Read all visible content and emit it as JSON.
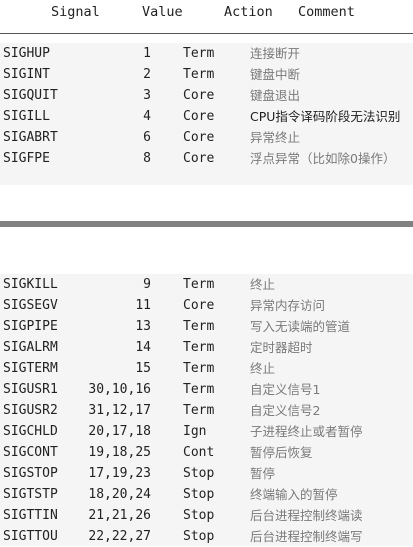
{
  "header": {
    "signal": "Signal",
    "value": "Value",
    "action": "Action",
    "comment": "Comment"
  },
  "table1": [
    {
      "signal": "SIGHUP",
      "value": "1",
      "action": "Term",
      "comment": "连接断开"
    },
    {
      "signal": "SIGINT",
      "value": "2",
      "action": "Term",
      "comment": "键盘中断"
    },
    {
      "signal": "SIGQUIT",
      "value": "3",
      "action": "Core",
      "comment": "键盘退出"
    },
    {
      "signal": "SIGILL",
      "value": "4",
      "action": "Core",
      "comment": "CPU指令译码阶段无法识别"
    },
    {
      "signal": "SIGABRT",
      "value": "6",
      "action": "Core",
      "comment": "异常终止"
    },
    {
      "signal": "SIGFPE",
      "value": "8",
      "action": "Core",
      "comment": "浮点异常（比如除0操作）"
    }
  ],
  "table2": [
    {
      "signal": "SIGKILL",
      "value": "9",
      "action": "Term",
      "comment": "终止"
    },
    {
      "signal": "SIGSEGV",
      "value": "11",
      "action": "Core",
      "comment": "异常内存访问"
    },
    {
      "signal": "SIGPIPE",
      "value": "13",
      "action": "Term",
      "comment": "写入无读端的管道"
    },
    {
      "signal": "SIGALRM",
      "value": "14",
      "action": "Term",
      "comment": "定时器超时"
    },
    {
      "signal": "SIGTERM",
      "value": "15",
      "action": "Term",
      "comment": "终止"
    },
    {
      "signal": "SIGUSR1",
      "value": "30,10,16",
      "action": "Term",
      "comment": "自定义信号1"
    },
    {
      "signal": "SIGUSR2",
      "value": "31,12,17",
      "action": "Term",
      "comment": "自定义信号2"
    },
    {
      "signal": "SIGCHLD",
      "value": "20,17,18",
      "action": "Ign",
      "comment": "子进程终止或者暂停"
    },
    {
      "signal": "SIGCONT",
      "value": "19,18,25",
      "action": "Cont",
      "comment": "暂停后恢复"
    },
    {
      "signal": "SIGSTOP",
      "value": "17,19,23",
      "action": "Stop",
      "comment": "暂停"
    },
    {
      "signal": "SIGTSTP",
      "value": "18,20,24",
      "action": "Stop",
      "comment": "终端输入的暂停"
    },
    {
      "signal": "SIGTTIN",
      "value": "21,21,26",
      "action": "Stop",
      "comment": "后台进程控制终端读"
    },
    {
      "signal": "SIGTTOU",
      "value": "22,22,27",
      "action": "Stop",
      "comment": "后台进程控制终端写"
    }
  ],
  "colors": {
    "row_background": "#f5f5f5",
    "separator": "#808080",
    "comment_text": "#7a7a7a"
  }
}
